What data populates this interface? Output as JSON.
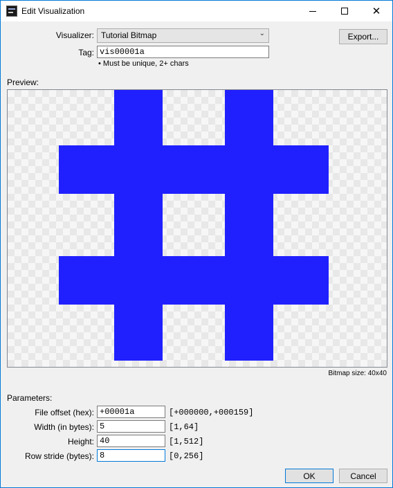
{
  "window": {
    "title": "Edit Visualization",
    "close_glyph": "✕",
    "app_icon": "app-logo-icon"
  },
  "visualizer": {
    "label": "Visualizer:",
    "selected": "Tutorial Bitmap",
    "arrow": "⌄"
  },
  "export_button": "Export...",
  "tag": {
    "label": "Tag:",
    "value": "vis00001a",
    "hint": "• Must be unique, 2+ chars"
  },
  "preview": {
    "label": "Preview:",
    "bitmap_size": "Bitmap size: 40x40",
    "pixel_color": "#2020ff"
  },
  "parameters": {
    "heading": "Parameters:",
    "rows": [
      {
        "label": "File offset (hex):",
        "value": "+00001a",
        "range": "[+000000,+000159]"
      },
      {
        "label": "Width (in bytes):",
        "value": "5",
        "range": "[1,64]"
      },
      {
        "label": "Height:",
        "value": "40",
        "range": "[1,512]"
      },
      {
        "label": "Row stride (bytes):",
        "value": "8",
        "range": "[0,256]"
      }
    ]
  },
  "buttons": {
    "ok": "OK",
    "cancel": "Cancel"
  }
}
